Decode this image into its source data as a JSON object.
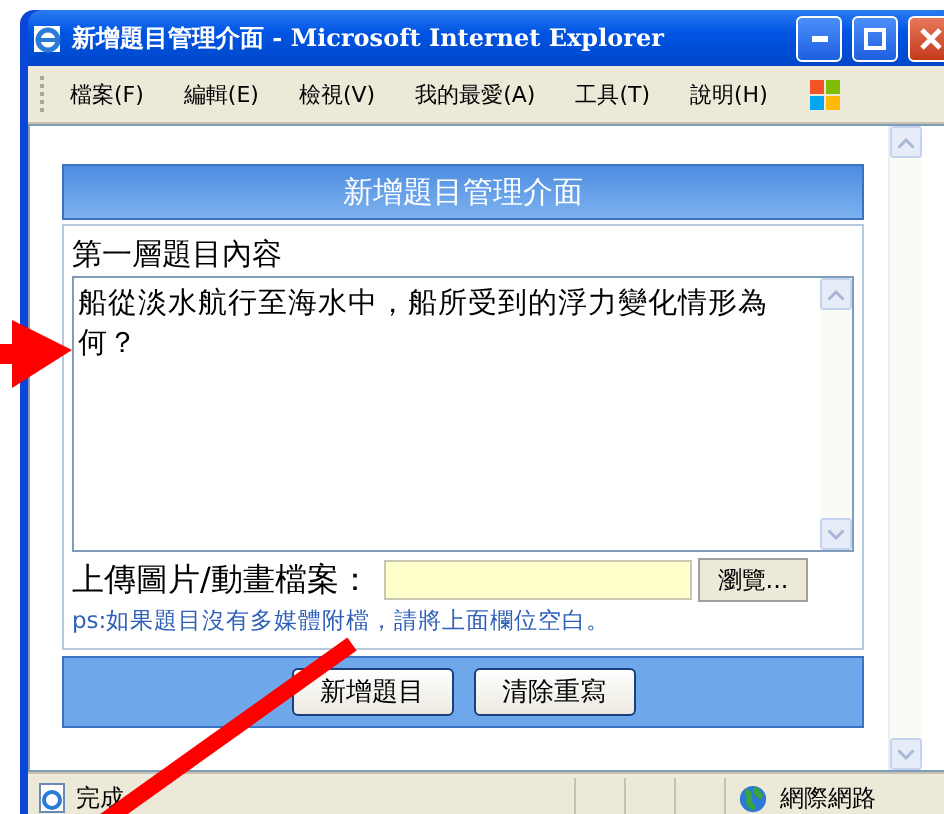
{
  "window": {
    "title": "新增題目管理介面 - Microsoft Internet Explorer"
  },
  "menu": [
    "檔案(F)",
    "編輯(E)",
    "檢視(V)",
    "我的最愛(A)",
    "工具(T)",
    "說明(H)"
  ],
  "form": {
    "header": "新增題目管理介面",
    "question_label": "第一層題目內容",
    "question_text": "船從淡水航行至海水中，船所受到的浮力變化情形為何？",
    "upload_label": "上傳圖片/動畫檔案：",
    "browse_button": "瀏覽...",
    "note": "ps:如果題目沒有多媒體附檔，請將上面欄位空白。",
    "buttons": [
      "新增題目",
      "清除重寫"
    ]
  },
  "status_bar": {
    "status": "完成",
    "zone": "網際網路"
  }
}
